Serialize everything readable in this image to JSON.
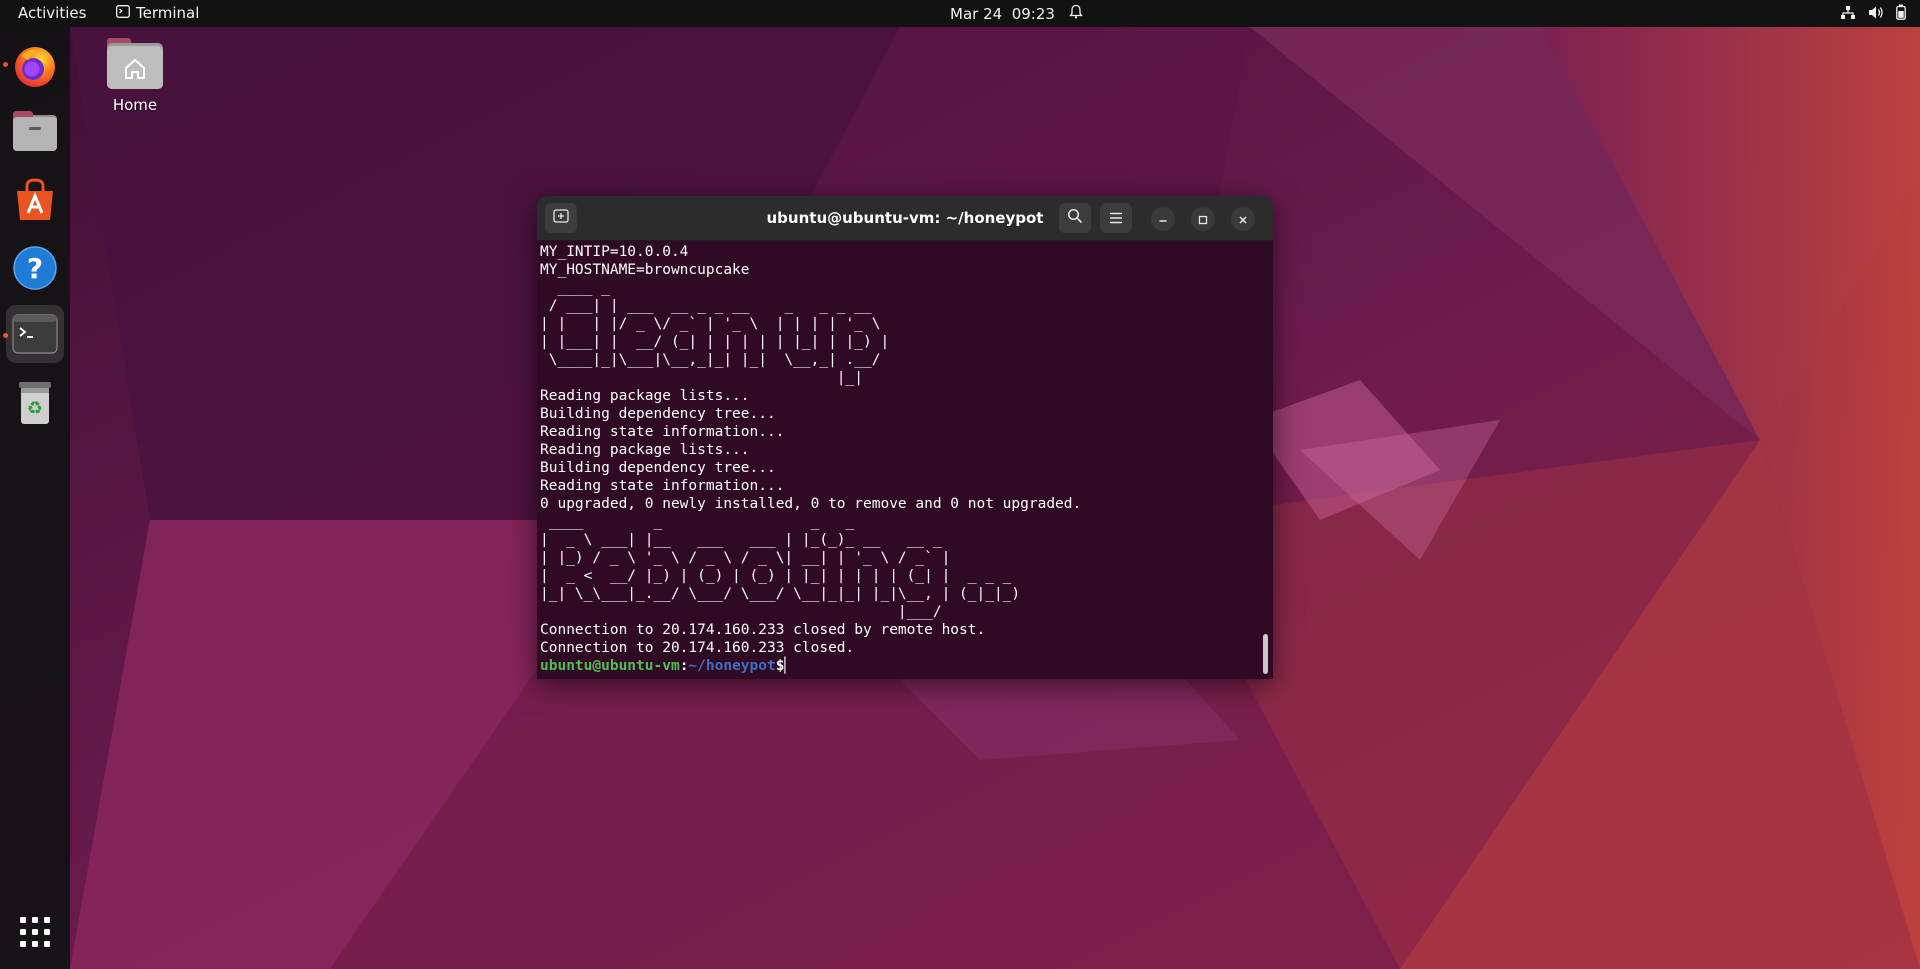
{
  "topbar": {
    "activities": "Activities",
    "app_name": "Terminal",
    "date_time": "Mar 24  09:23"
  },
  "desktop": {
    "home_label": "Home"
  },
  "dock": {
    "apps": [
      "firefox-icon",
      "files-icon",
      "app-center-icon",
      "help-icon",
      "terminal-icon",
      "trash-icon",
      "show-apps-icon"
    ]
  },
  "terminal": {
    "title": "ubuntu@ubuntu-vm: ~/honeypot",
    "output": "MY_INTIP=10.0.0.4\nMY_HOSTNAME=browncupcake\n  ____ _\n / ___| | ___  __ _ _ __    _   _ _ __\n| |   | |/ _ \\/ _` | '_ \\  | | | | '_ \\\n| |___| |  __/ (_| | | | | | |_| | |_) |\n \\____|_|\\___|\\__,_|_| |_|  \\__,_| .__/\n                                  |_|\nReading package lists...\nBuilding dependency tree...\nReading state information...\nReading package lists...\nBuilding dependency tree...\nReading state information...\n0 upgraded, 0 newly installed, 0 to remove and 0 not upgraded.\n ____        _                 _   _\n|  _ \\ ___| |__   ___   ___ | |_(_)_ __   __ _\n| |_) / _ \\ '_ \\ / _ \\ / _ \\| __| | '_ \\ / _` |\n|  _ <  __/ |_) | (_) | (_) | |_| | | | | (_| |  _ _ _\n|_| \\_\\___|_.__/ \\___/ \\___/ \\__|_|_| |_|\\__, | (_|_|_)\n                                         |___/\nConnection to 20.174.160.233 closed by remote host.\nConnection to 20.174.160.233 closed.",
    "prompt_user": "ubuntu@ubuntu-vm",
    "prompt_sep": ":",
    "prompt_path": "~/honeypot",
    "prompt_symbol": "$"
  },
  "colors": {
    "terminal_bg": "#300a24",
    "prompt_user": "#4fc04f",
    "prompt_path": "#3e6fc4",
    "accent": "#e95420"
  }
}
